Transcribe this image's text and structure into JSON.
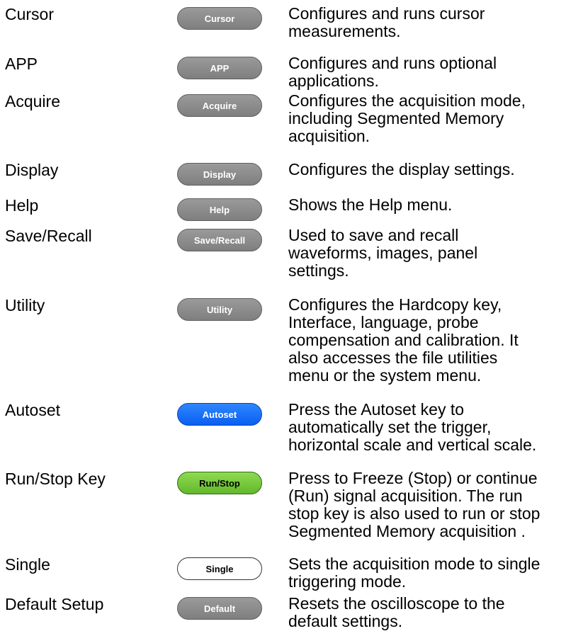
{
  "rows": [
    {
      "label": "Cursor",
      "key": "Cursor",
      "desc": [
        "Configures and runs cursor",
        "measurements."
      ]
    },
    {
      "label": "APP",
      "key": "APP",
      "desc": [
        "Configures and runs optional",
        "applications."
      ]
    },
    {
      "label": "Acquire",
      "key": "Acquire",
      "desc": [
        "Configures the acquisition mode,",
        "including Segmented Memory",
        "acquisition."
      ]
    },
    {
      "label": "Display",
      "key": "Display",
      "desc": [
        "Configures the display settings."
      ]
    },
    {
      "label": "Help",
      "key": "Help",
      "desc": [
        "Shows the Help menu."
      ]
    },
    {
      "label": "Save/Recall",
      "key": "Save/Recall",
      "desc": [
        "Used to save and recall",
        "waveforms, images, panel",
        "settings."
      ]
    },
    {
      "label": "Utility",
      "key": "Utility",
      "desc": [
        "Configures the Hardcopy key,",
        "Interface, language, probe",
        "compensation and calibration.  It",
        "also accesses the file utilities",
        "menu or the system menu."
      ]
    },
    {
      "label": "Autoset",
      "key": "Autoset",
      "desc": [
        "Press the Autoset key to",
        "automatically set the trigger,",
        "horizontal scale and vertical scale."
      ]
    },
    {
      "label": "Run/Stop Key",
      "key": "Run/Stop",
      "desc": [
        "Press to Freeze (Stop) or continue",
        "(Run) signal acquisition. The run",
        "stop key is also used to run or stop",
        "Segmented Memory acquisition ."
      ]
    },
    {
      "label": "Single",
      "key": "Single",
      "desc": [
        "Sets the acquisition mode to single",
        "triggering mode."
      ]
    },
    {
      "label": "Default Setup",
      "key": "Default",
      "desc": [
        "Resets the oscilloscope to the",
        "default settings."
      ]
    }
  ],
  "colors": {
    "key_grey": "#8c8c8c",
    "key_autoset": "#1a6ff5",
    "key_runstop": "#7acb3e",
    "key_single": "#ffffff"
  }
}
